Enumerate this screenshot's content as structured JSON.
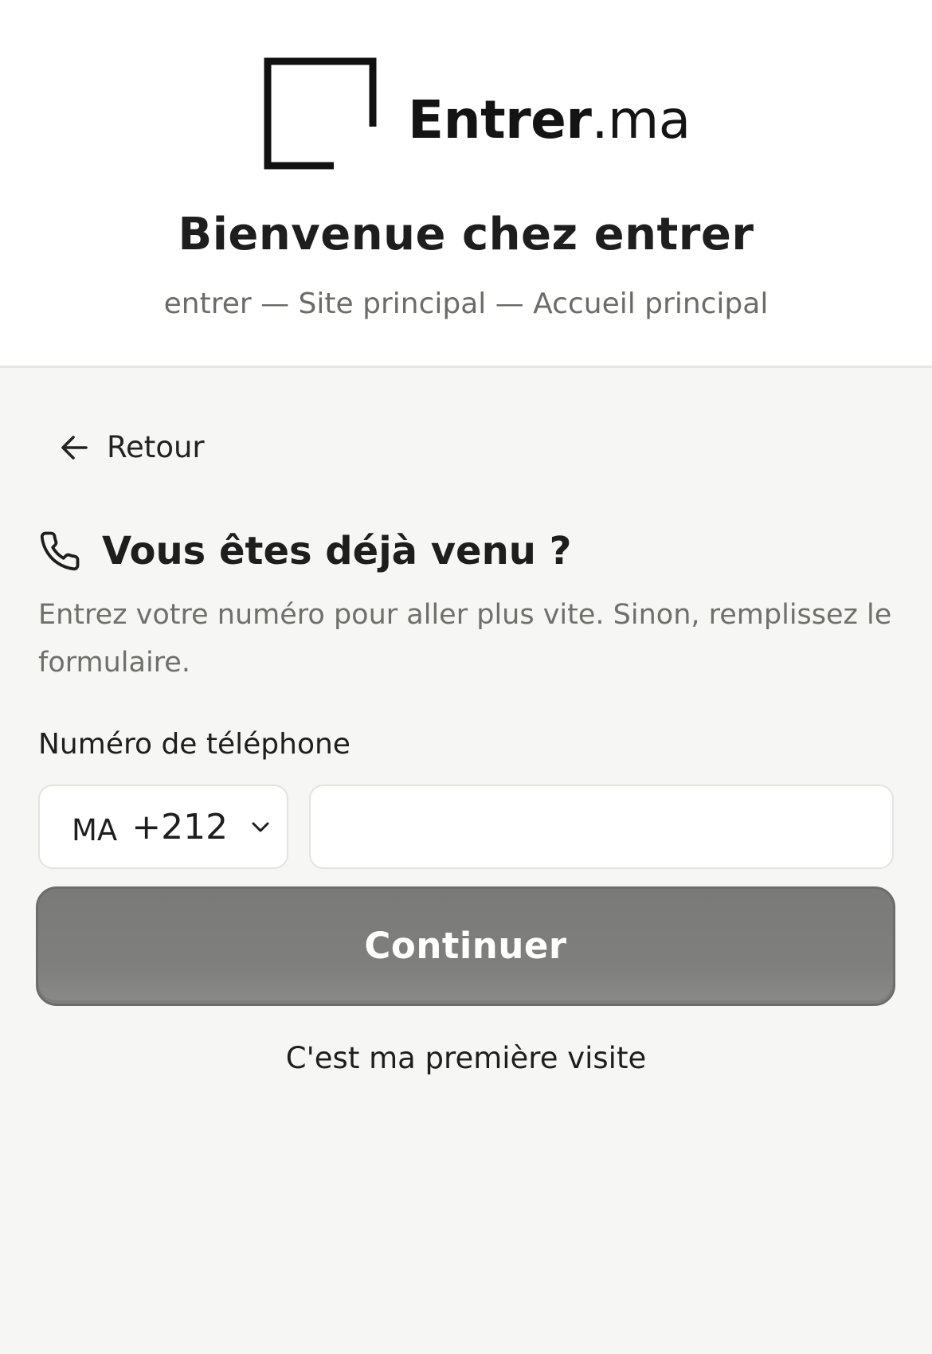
{
  "brand": {
    "name_main": "Entrer",
    "name_suffix": ".ma",
    "logo_icon": "open-square-logo-icon"
  },
  "header": {
    "title": "Bienvenue chez entrer",
    "subtitle": "entrer — Site principal — Accueil principal"
  },
  "nav": {
    "back_label": "Retour",
    "back_icon": "arrow-left-icon"
  },
  "section": {
    "icon": "phone-icon",
    "title": "Vous êtes déjà venu ?",
    "description": "Entrez votre numéro pour aller plus vite. Sinon, remplissez le formulaire."
  },
  "form": {
    "phone_label": "Numéro de téléphone",
    "country_code": "MA",
    "dial_code": "+212",
    "phone_value": "",
    "phone_placeholder": "",
    "continue_label": "Continuer"
  },
  "footer_link": {
    "first_visit_label": "C'est ma première visite"
  },
  "colors": {
    "page_background": "#f6f6f4",
    "header_background": "#ffffff",
    "button_background": "#7f7f7d",
    "muted_text": "#6f6f6b"
  }
}
